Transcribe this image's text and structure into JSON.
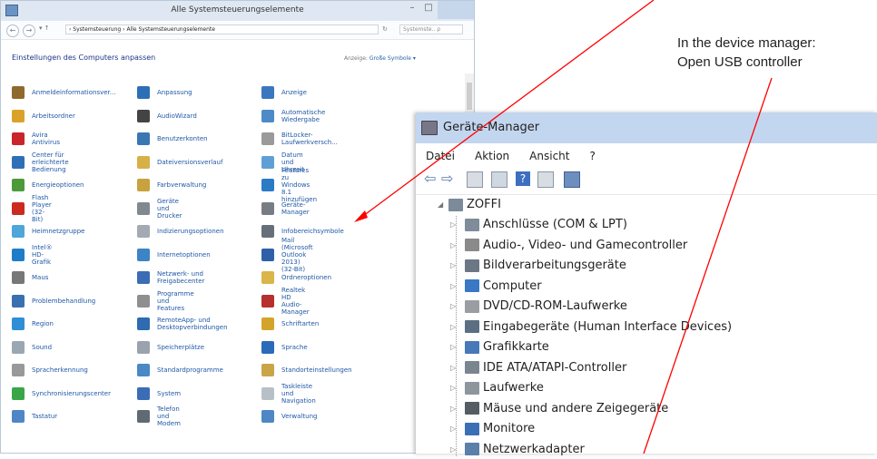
{
  "control_panel": {
    "window_title": "Alle Systemsteuerungselemente",
    "breadcrumb": "›  Systemsteuerung  ›  Alle Systemsteuerungselemente",
    "search_placeholder": "Systemste..  ρ",
    "heading": "Einstellungen des Computers anpassen",
    "view_by_label": "Anzeige:",
    "view_by_value": "Große Symbole ▾",
    "items_col1": [
      "Anmeldeinformationsver...",
      "Arbeitsordner",
      "Avira Antivirus",
      "Center für erleichterte\nBedienung",
      "Energieoptionen",
      "Flash Player (32-Bit)",
      "Heimnetzgruppe",
      "Intel® HD-Grafik",
      "Maus",
      "Problembehandlung",
      "Region",
      "Sound",
      "Spracherkennung",
      "Synchronisierungscenter",
      "Tastatur"
    ],
    "items_col2": [
      "Anpassung",
      "AudioWizard",
      "Benutzerkonten",
      "Dateiversionsverlauf",
      "Farbverwaltung",
      "Geräte und Drucker",
      "Indizierungsoptionen",
      "Internetoptionen",
      "Netzwerk- und\nFreigabecenter",
      "Programme und Features",
      "RemoteApp- und\nDesktopverbindungen",
      "Speicherplätze",
      "Standardprogramme",
      "System",
      "Telefon und Modem"
    ],
    "items_col3": [
      "Anzeige",
      "Automatische Wiedergabe",
      "BitLocker-Laufwerkversch...",
      "Datum und Uhrzeit",
      "Features zu Windows 8.1\nhinzufügen",
      "Geräte-Manager",
      "Infobereichsymbole",
      "Mail (Microsoft Outlook\n2013) (32-Bit)",
      "Ordneroptionen",
      "Realtek HD\nAudio-Manager",
      "Schriftarten",
      "Sprache",
      "Standorteinstellungen",
      "Taskleiste und Navigation",
      "Verwaltung"
    ]
  },
  "device_manager": {
    "window_title": "Geräte-Manager",
    "menu": [
      "Datei",
      "Aktion",
      "Ansicht",
      "?"
    ],
    "root": "ZOFFI",
    "nodes": [
      "Anschlüsse (COM & LPT)",
      "Audio-, Video- und Gamecontroller",
      "Bildverarbeitungsgeräte",
      "Computer",
      "DVD/CD-ROM-Laufwerke",
      "Eingabegeräte (Human Interface Devices)",
      "Grafikkarte",
      "IDE ATA/ATAPI-Controller",
      "Laufwerke",
      "Mäuse und andere Zeigegeräte",
      "Monitore",
      "Netzwerkadapter"
    ]
  },
  "annotation": {
    "line1": "In the device manager:",
    "line2": "Open USB controller",
    "arrow_color": "#ff0000"
  },
  "icon_colors_col1": [
    "#8f6a2e",
    "#d9a32a",
    "#c9252b",
    "#2f6fb8",
    "#4c9a3a",
    "#cc2a1f",
    "#4fa6d8",
    "#1e7dc8",
    "#777777",
    "#3a6fb0",
    "#2f8fd6",
    "#9aa7b3",
    "#999999",
    "#3aa64a",
    "#4f86c6"
  ],
  "icon_colors_col2": [
    "#2d6fb7",
    "#444444",
    "#3a76b3",
    "#d7b048",
    "#c8a23e",
    "#808890",
    "#a3aab2",
    "#3d84c6",
    "#3a6db5",
    "#8f8f8f",
    "#2e6bb0",
    "#9aa3ad",
    "#4a88c6",
    "#3a6db5",
    "#606a73"
  ],
  "icon_colors_col3": [
    "#3a77bf",
    "#4c8ac8",
    "#9a9a9a",
    "#5ea0d6",
    "#2b7ac6",
    "#777d83",
    "#677079",
    "#2f5fa8",
    "#d9b54a",
    "#b72f2f",
    "#d4a42a",
    "#2b6bb8",
    "#c9a547",
    "#b8c0c7",
    "#4e87c3"
  ],
  "device_icon_colors": [
    "#7f8c99",
    "#8a8a8a",
    "#6b7785",
    "#3878c5",
    "#9a9ea3",
    "#5c6e82",
    "#4778b8",
    "#7b8590",
    "#8d959d",
    "#555c63",
    "#3b6fb5",
    "#5b7fa8"
  ]
}
